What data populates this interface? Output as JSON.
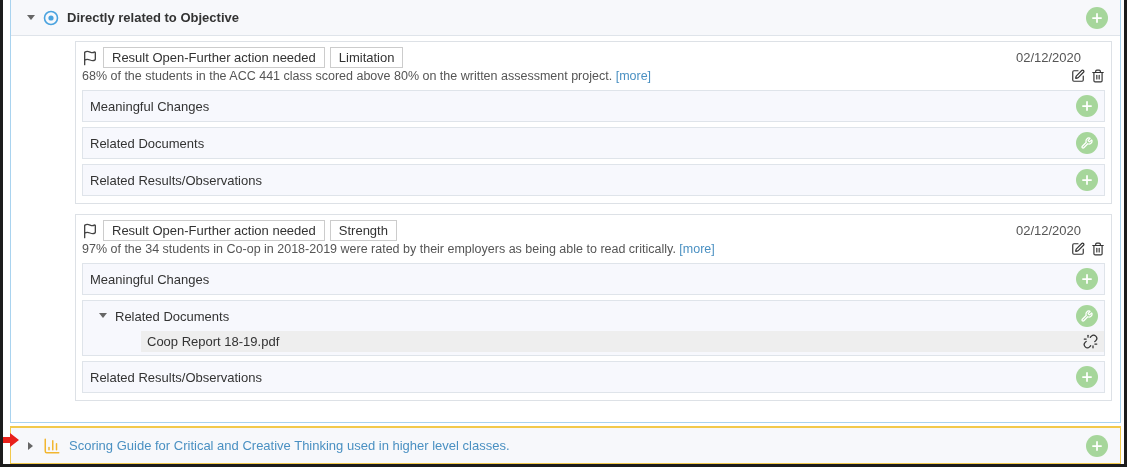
{
  "sections": [
    {
      "kind": "objective",
      "title": "Directly related to Objective",
      "expanded": true,
      "results": [
        {
          "tags": [
            "Result Open-Further action needed",
            "Limitation"
          ],
          "date": "02/12/2020",
          "text": "68% of the students in the ACC 441 class scored above 80% on the written assessment project.",
          "more": "[more]",
          "subsections": [
            {
              "title": "Meaningful Changes",
              "kind": "add",
              "expanded": false
            },
            {
              "title": "Related Documents",
              "kind": "tools",
              "expanded": false
            },
            {
              "title": "Related Results/Observations",
              "kind": "add",
              "expanded": false
            }
          ]
        },
        {
          "tags": [
            "Result Open-Further action needed",
            "Strength"
          ],
          "date": "02/12/2020",
          "text": "97% of the 34 students in Co-op in 2018-2019 were rated by their employers as being able to read critically.",
          "more": "[more]",
          "subsections": [
            {
              "title": "Meaningful Changes",
              "kind": "add",
              "expanded": false
            },
            {
              "title": "Related Documents",
              "kind": "tools",
              "expanded": true,
              "documents": [
                "Coop Report 18-19.pdf"
              ]
            },
            {
              "title": "Related Results/Observations",
              "kind": "add",
              "expanded": false
            }
          ]
        }
      ]
    },
    {
      "kind": "scoring-guide",
      "title": "Scoring Guide for Critical and Creative Thinking used in higher level classes.",
      "expanded": false
    }
  ]
}
